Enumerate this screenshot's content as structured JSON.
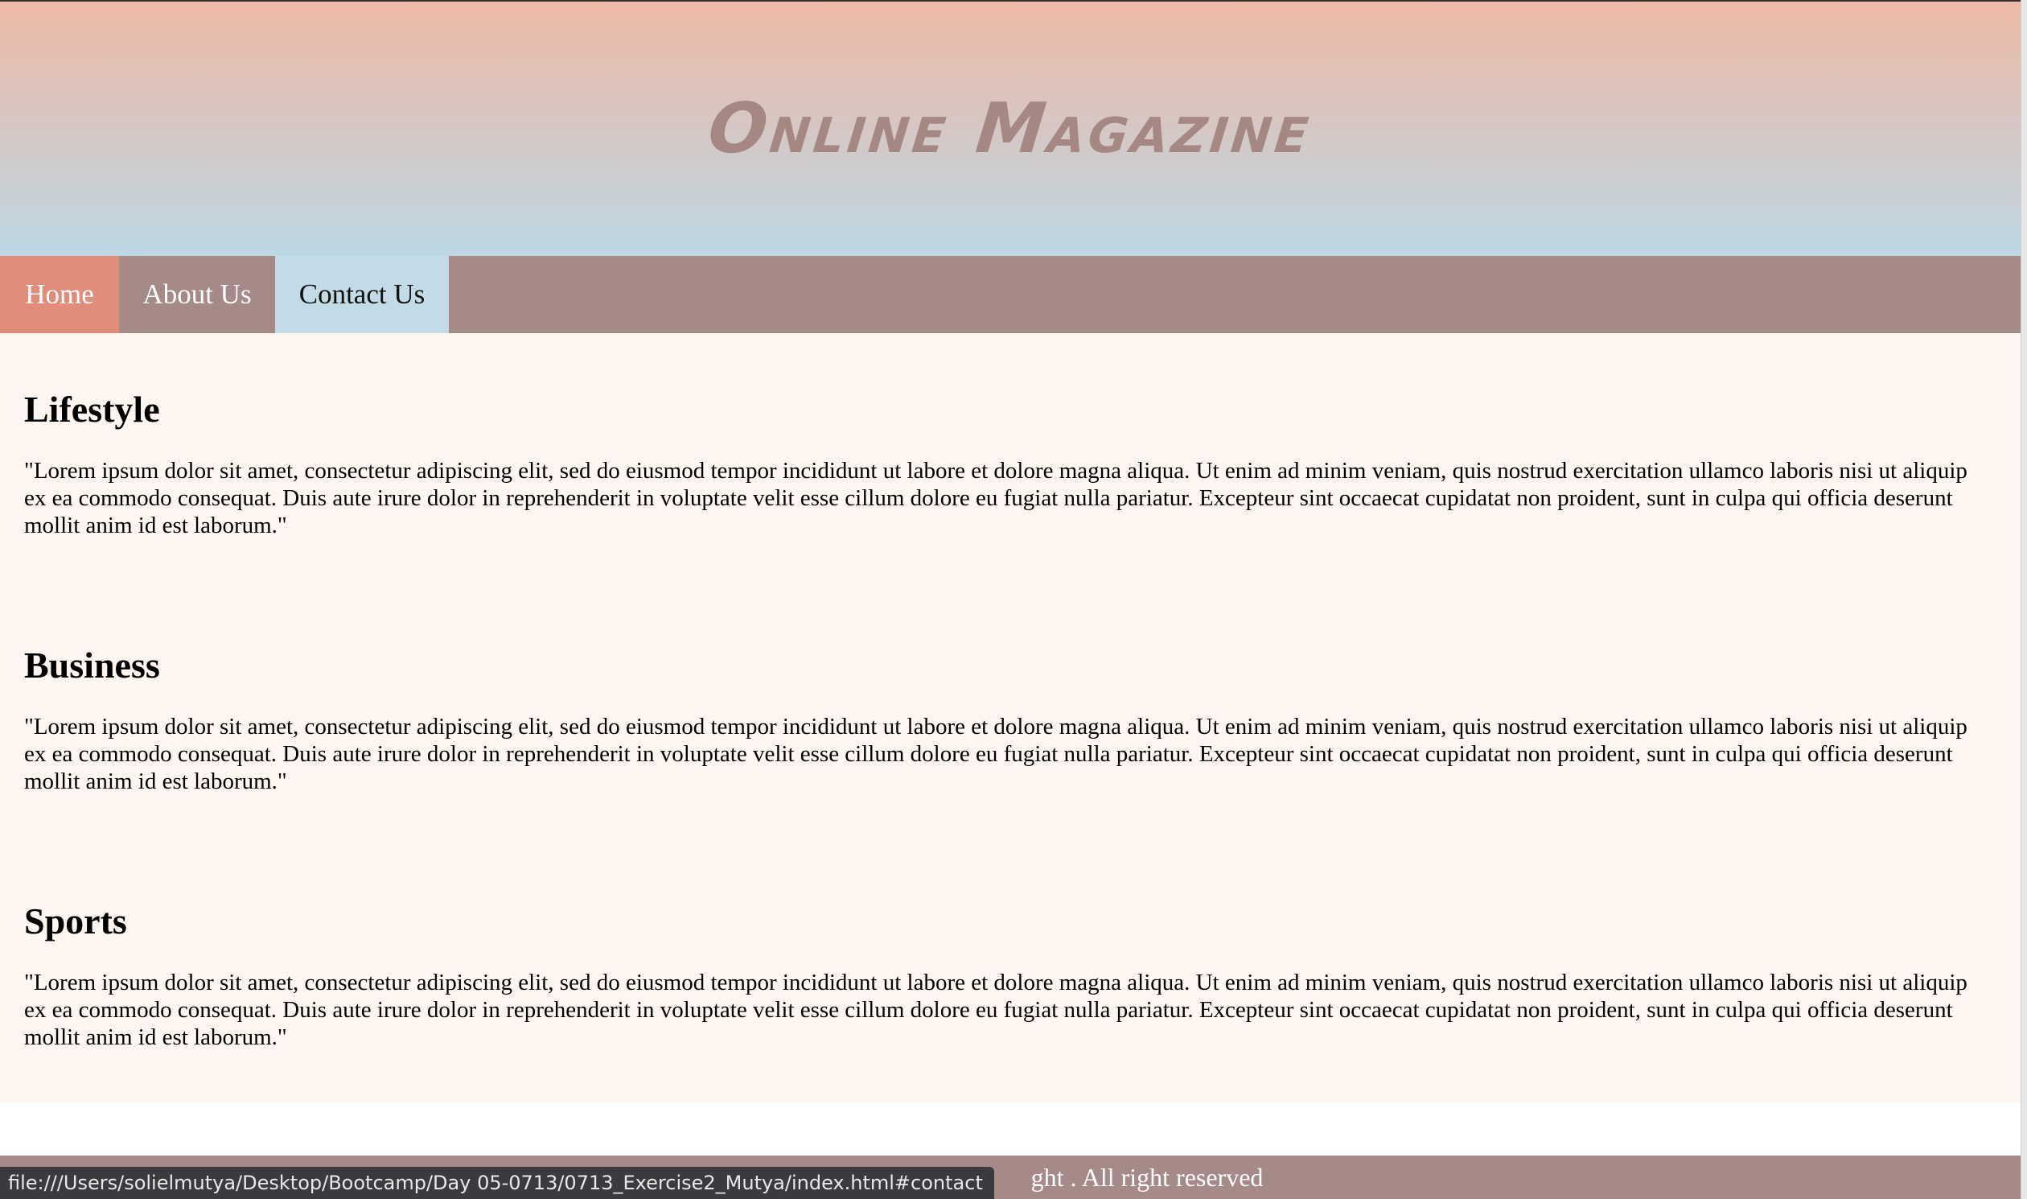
{
  "header": {
    "title": "Online Magazine"
  },
  "nav": {
    "items": [
      {
        "label": "Home"
      },
      {
        "label": "About Us"
      },
      {
        "label": "Contact Us"
      }
    ]
  },
  "sections": [
    {
      "heading": "Lifestyle",
      "body": "\"Lorem ipsum dolor sit amet, consectetur adipiscing elit, sed do eiusmod tempor incididunt ut labore et dolore magna aliqua. Ut enim ad minim veniam, quis nostrud exercitation ullamco laboris nisi ut aliquip ex ea commodo consequat. Duis aute irure dolor in reprehenderit in voluptate velit esse cillum dolore eu fugiat nulla pariatur. Excepteur sint occaecat cupidatat non proident, sunt in culpa qui officia deserunt mollit anim id est laborum.\""
    },
    {
      "heading": "Business",
      "body": "\"Lorem ipsum dolor sit amet, consectetur adipiscing elit, sed do eiusmod tempor incididunt ut labore et dolore magna aliqua. Ut enim ad minim veniam, quis nostrud exercitation ullamco laboris nisi ut aliquip ex ea commodo consequat. Duis aute irure dolor in reprehenderit in voluptate velit esse cillum dolore eu fugiat nulla pariatur. Excepteur sint occaecat cupidatat non proident, sunt in culpa qui officia deserunt mollit anim id est laborum.\""
    },
    {
      "heading": "Sports",
      "body": "\"Lorem ipsum dolor sit amet, consectetur adipiscing elit, sed do eiusmod tempor incididunt ut labore et dolore magna aliqua. Ut enim ad minim veniam, quis nostrud exercitation ullamco laboris nisi ut aliquip ex ea commodo consequat. Duis aute irure dolor in reprehenderit in voluptate velit esse cillum dolore eu fugiat nulla pariatur. Excepteur sint occaecat cupidatat non proident, sunt in culpa qui officia deserunt mollit anim id est laborum.\""
    }
  ],
  "footer": {
    "text": "ght . All right reserved"
  },
  "status_bar": {
    "url": "file:///Users/solielmutya/Desktop/Bootcamp/Day 05-0713/0713_Exercise2_Mutya/index.html#contact"
  },
  "colors": {
    "header_gradient_top": "#edbaa6",
    "header_gradient_bottom": "#bcd8e4",
    "title": "#a58783",
    "nav_bar": "#a58a87",
    "nav_home": "#e08d7c",
    "nav_contact": "#c2dbe6",
    "content_bg": "#fdf5f0",
    "footer_bg": "#a58a87"
  }
}
